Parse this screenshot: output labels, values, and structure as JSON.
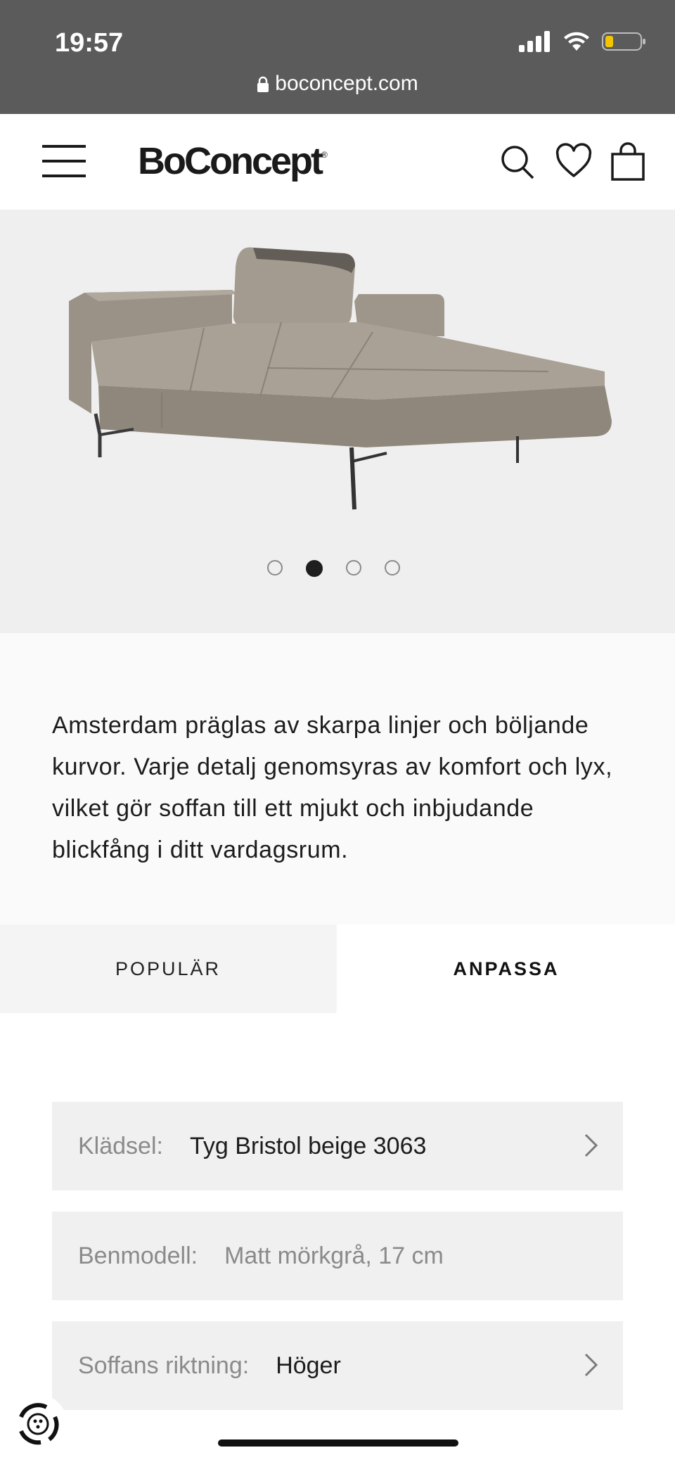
{
  "status_bar": {
    "time": "19:57",
    "url": "boconcept.com"
  },
  "header": {
    "logo_text": "BoConcept",
    "logo_mark": "®",
    "icons": [
      "menu-icon",
      "search-icon",
      "heart-icon",
      "bag-icon"
    ]
  },
  "gallery": {
    "image_alt": "Amsterdam sofa",
    "dot_count": 4,
    "active_index": 1
  },
  "description": "Amsterdam präglas av skarpa linjer och böljande kurvor. Varje detalj genomsyras av komfort och lyx, vilket gör soffan till ett mjukt och inbjudande blickfång i ditt vardagsrum.",
  "tabs": {
    "popular": "POPULÄR",
    "customize": "ANPASSA",
    "active": "customize"
  },
  "options": [
    {
      "label": "Klädsel:",
      "value": "Tyg Bristol beige 3063",
      "has_chevron": true
    },
    {
      "label": "Benmodell:",
      "value": "Matt mörkgrå, 17 cm",
      "has_chevron": false
    },
    {
      "label": "Soffans riktning:",
      "value": "Höger",
      "has_chevron": true
    }
  ],
  "colors": {
    "status_bar_bg": "#5b5b5b",
    "hero_bg": "#efefef",
    "option_bg": "#f0f0f0",
    "battery_level": "#f2c500"
  }
}
